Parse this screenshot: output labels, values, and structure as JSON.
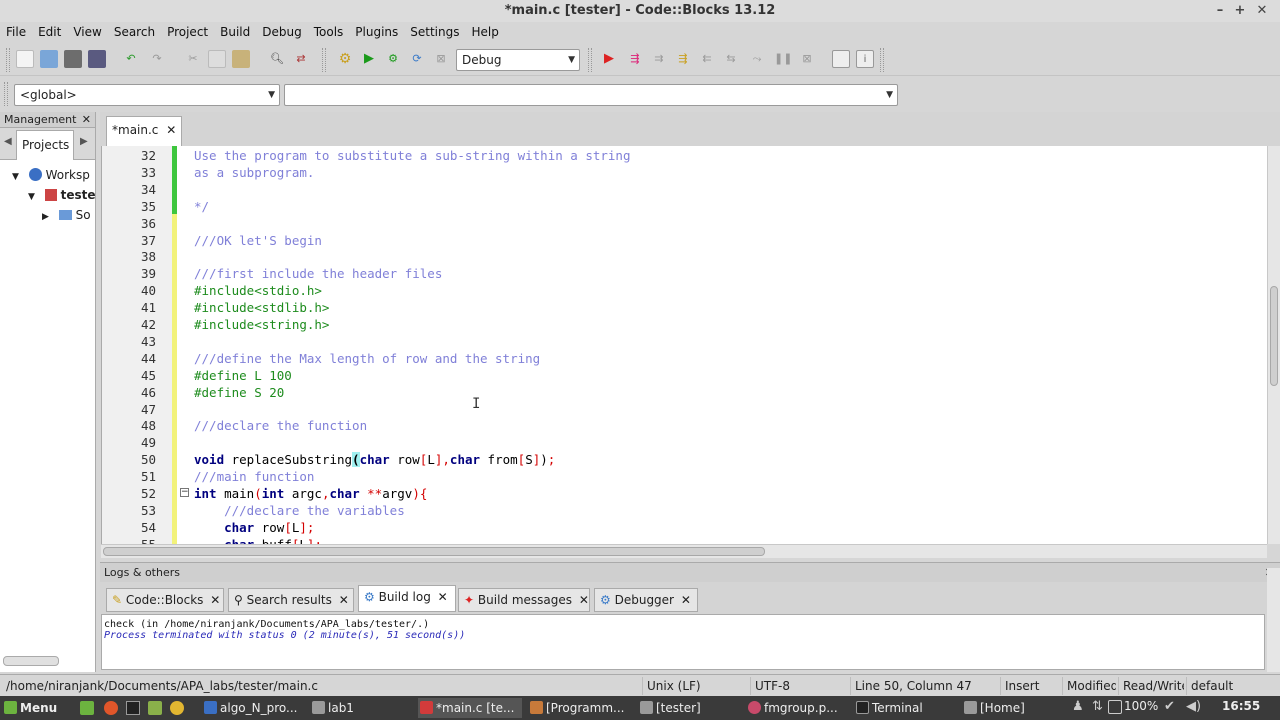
{
  "window": {
    "title": "*main.c [tester] - Code::Blocks 13.12"
  },
  "menubar": [
    "File",
    "Edit",
    "View",
    "Search",
    "Project",
    "Build",
    "Debug",
    "Tools",
    "Plugins",
    "Settings",
    "Help"
  ],
  "toolbar": {
    "build_target": "Debug"
  },
  "scopebar": {
    "scope": "<global>",
    "symbol": ""
  },
  "management": {
    "title": "Management",
    "tab": "Projects",
    "tree": [
      {
        "label": "Worksp",
        "level": 0
      },
      {
        "label": "teste",
        "level": 1
      },
      {
        "label": "So",
        "level": 2
      }
    ]
  },
  "editor": {
    "tab": "*main.c",
    "lines": [
      {
        "n": "32",
        "text": "Use the program to substitute a sub-string within a string"
      },
      {
        "n": "33",
        "text": "as a subprogram."
      },
      {
        "n": "34",
        "text": ""
      },
      {
        "n": "35",
        "text": "*/"
      },
      {
        "n": "36",
        "text": ""
      },
      {
        "n": "37",
        "text": "///OK let'S begin"
      },
      {
        "n": "38",
        "text": ""
      },
      {
        "n": "39",
        "text": "///first include the header files"
      },
      {
        "n": "40",
        "text": "#include<stdio.h>"
      },
      {
        "n": "41",
        "text": "#include<stdlib.h>"
      },
      {
        "n": "42",
        "text": "#include<string.h>"
      },
      {
        "n": "43",
        "text": ""
      },
      {
        "n": "44",
        "text": "///define the Max length of row and the string"
      },
      {
        "n": "45",
        "text": "#define L 100"
      },
      {
        "n": "46",
        "text": "#define S 20"
      },
      {
        "n": "47",
        "text": ""
      },
      {
        "n": "48",
        "text": "///declare the function"
      },
      {
        "n": "49",
        "text": ""
      },
      {
        "n": "50",
        "text": "void replaceSubstring(char row[L],char from[S]);"
      },
      {
        "n": "51",
        "text": "///main function"
      },
      {
        "n": "52",
        "text": "int main(int argc,char **argv){"
      },
      {
        "n": "53",
        "text": "    ///declare the variables"
      },
      {
        "n": "54",
        "text": "    char row[L];"
      },
      {
        "n": "55",
        "text": "    char buff[L];"
      }
    ]
  },
  "logs": {
    "title": "Logs & others",
    "tabs": [
      "Code::Blocks",
      "Search results",
      "Build log",
      "Build messages",
      "Debugger"
    ],
    "active_tab": "Build log",
    "output": [
      "check   (in /home/niranjank/Documents/APA_labs/tester/.)",
      "Process terminated with status 0 (2 minute(s), 51 second(s))"
    ]
  },
  "statusbar": {
    "path": "/home/niranjank/Documents/APA_labs/tester/main.c",
    "eol": "Unix (LF)",
    "encoding": "UTF-8",
    "position": "Line 50, Column 47",
    "mode": "Insert",
    "modified": "Modified",
    "access": "Read/Write",
    "profile": "default"
  },
  "taskbar": {
    "menu": "Menu",
    "tasks": [
      "algo_N_pro...",
      "lab1",
      "*main.c [te...",
      "[Programm...",
      "[tester]",
      "fmgroup.p...",
      "Terminal",
      "[Home]"
    ],
    "battery": "100%",
    "clock": "16:55"
  }
}
